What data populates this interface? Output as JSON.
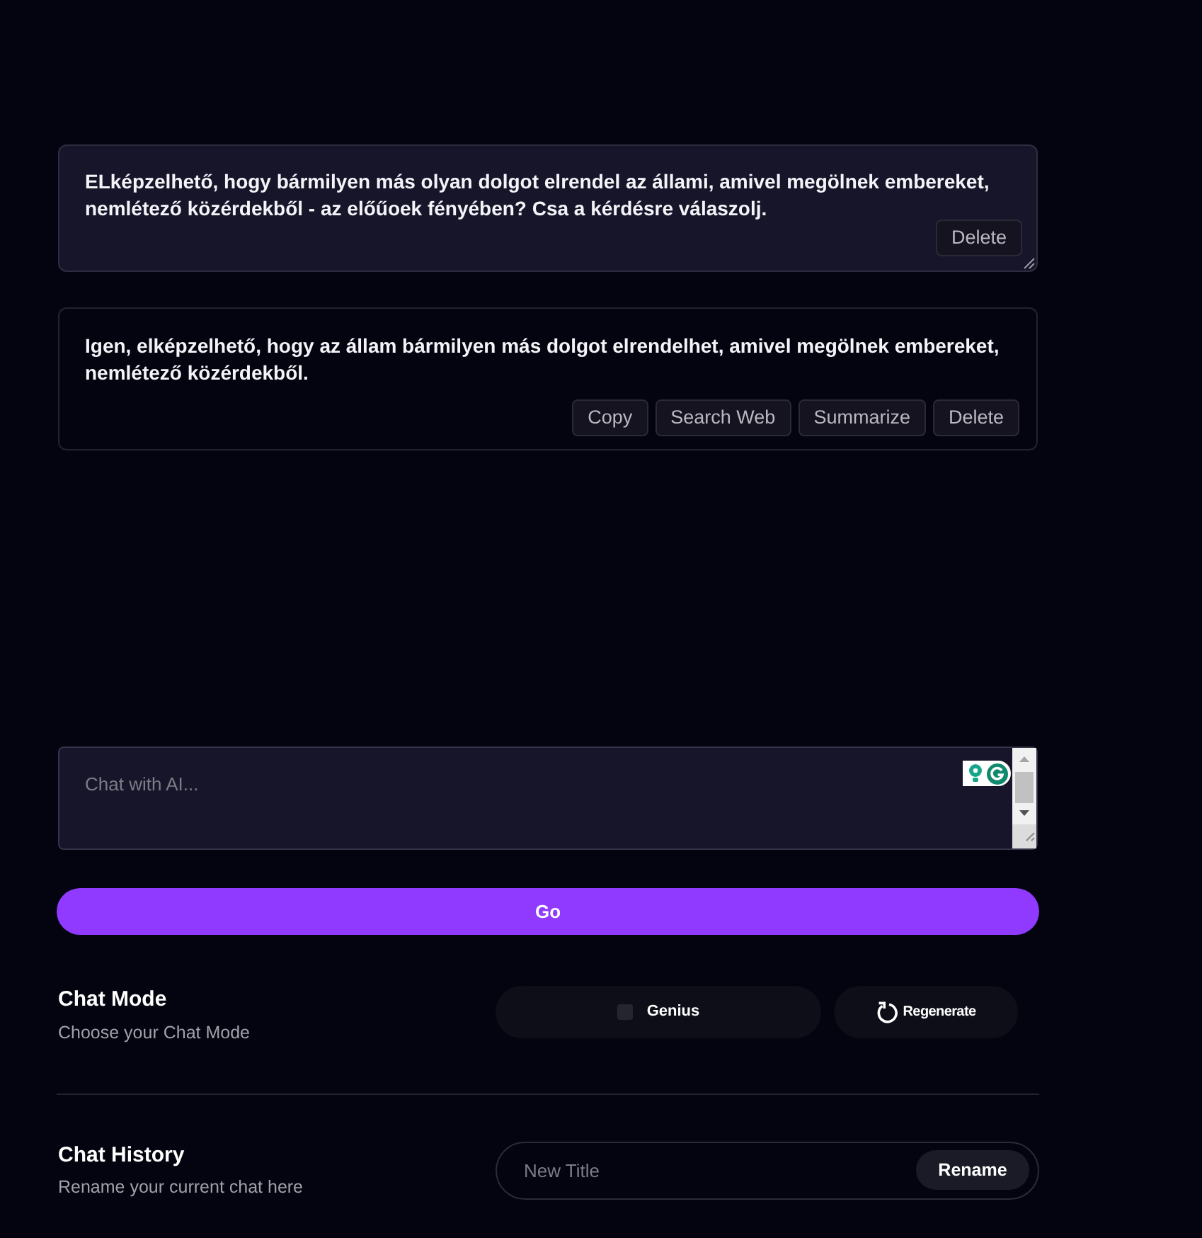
{
  "messages": [
    {
      "kind": "user",
      "text": "ELképzelhető, hogy bármilyen más olyan dolgot elrendel az állami, amivel megölnek embereket, nemlétező közérdekből - az előűoek fényében? Csa a kérdésre válaszolj.",
      "actions": [
        "Delete"
      ]
    },
    {
      "kind": "assistant",
      "text": "Igen, elképzelhető, hogy az állam bármilyen más dolgot elrendelhet, amivel megölnek embereket, nemlétező közérdekből.",
      "actions": [
        "Copy",
        "Search Web",
        "Summarize",
        "Delete"
      ]
    }
  ],
  "chat_input": {
    "placeholder": "Chat with AI..."
  },
  "go_button": "Go",
  "chat_mode": {
    "title": "Chat Mode",
    "subtitle": "Choose your Chat Mode",
    "toggle": {
      "label": "Genius",
      "checked": false
    },
    "regenerate_button": "Regenerate"
  },
  "chat_history": {
    "title": "Chat History",
    "subtitle": "Rename your current chat here",
    "title_field": {
      "placeholder": "New Title"
    },
    "rename_button": "Rename"
  }
}
